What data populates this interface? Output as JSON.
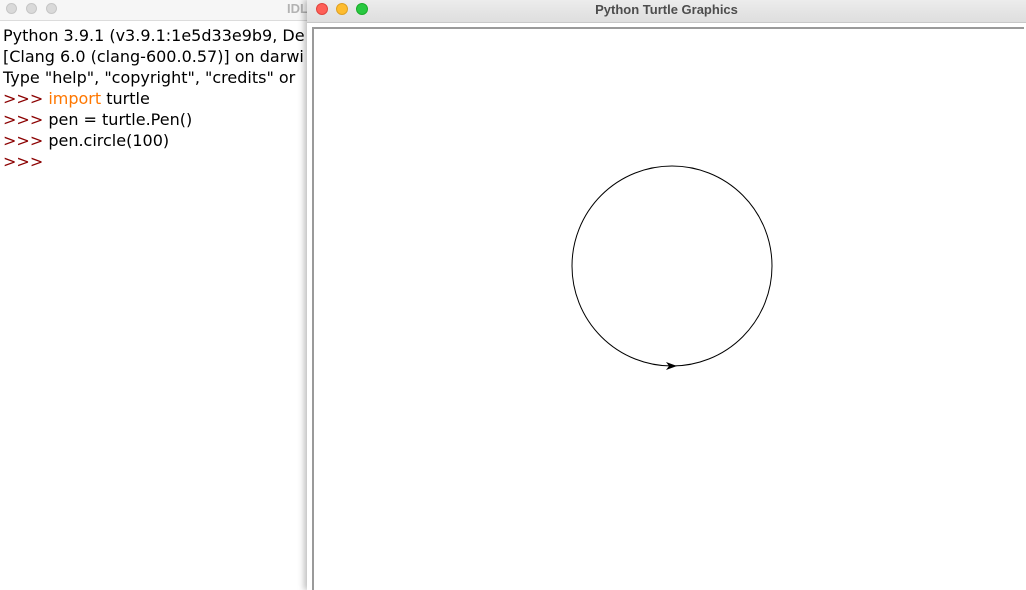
{
  "idle_window": {
    "title": "IDL",
    "lines": [
      {
        "text": "Python 3.9.1 (v3.9.1:1e5d33e9b9, De"
      },
      {
        "text": "[Clang 6.0 (clang-600.0.57)] on darwi"
      },
      {
        "text": "Type \"help\", \"copyright\", \"credits\" or"
      }
    ],
    "commands": [
      {
        "prompt": ">>> ",
        "keyword": "import",
        "rest": " turtle"
      },
      {
        "prompt": ">>> ",
        "keyword": "",
        "rest": "pen = turtle.Pen()"
      },
      {
        "prompt": ">>> ",
        "keyword": "",
        "rest": "pen.circle(100)"
      },
      {
        "prompt": ">>>",
        "keyword": "",
        "rest": ""
      }
    ]
  },
  "turtle_window": {
    "title": "Python Turtle Graphics",
    "drawing": {
      "command": "circle",
      "radius": 100,
      "stroke_color": "#000000",
      "turtle_heading": "east"
    }
  },
  "colors": {
    "prompt": "#8b0000",
    "keyword": "#ff7700",
    "close": "#fe5f57",
    "minimize": "#febc2e",
    "zoom": "#28c840"
  }
}
